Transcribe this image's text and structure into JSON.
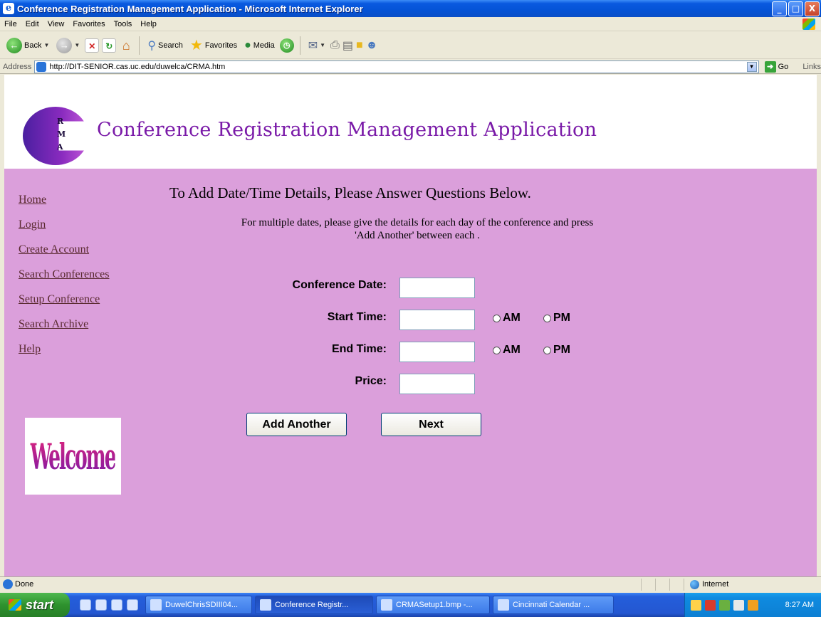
{
  "window": {
    "title": "Conference Registration Management Application - Microsoft Internet Explorer",
    "controls": [
      "_",
      "□",
      "X"
    ]
  },
  "menu": [
    "File",
    "Edit",
    "View",
    "Favorites",
    "Tools",
    "Help"
  ],
  "toolbar": {
    "back": "Back",
    "search": "Search",
    "favorites": "Favorites",
    "media": "Media"
  },
  "address": {
    "label": "Address",
    "url": "http://DIT-SENIOR.cas.uc.edu/duwelca/CRMA.htm",
    "go": "Go",
    "links": "Links"
  },
  "banner": {
    "logo_letters": [
      "R",
      "M",
      "A"
    ],
    "title": "Conference Registration Management Application"
  },
  "nav": [
    {
      "label": "Home"
    },
    {
      "label": "Login"
    },
    {
      "label": "Create Account"
    },
    {
      "label": "Search Conferences"
    },
    {
      "label": "Setup Conference"
    },
    {
      "label": "Search Archive"
    },
    {
      "label": "Help"
    }
  ],
  "welcome_image_text": "Welcome",
  "page": {
    "heading": "To Add Date/Time Details, Please Answer Questions Below.",
    "subtext_line1": "For multiple dates, please give the details for each day of the conference and press",
    "subtext_line2": "'Add Another' between each ."
  },
  "form": {
    "conference_date_label": "Conference Date:",
    "start_time_label": "Start Time:",
    "end_time_label": "End Time:",
    "price_label": "Price:",
    "am": "AM",
    "pm": "PM",
    "conference_date_value": "",
    "start_time_value": "",
    "end_time_value": "",
    "price_value": "",
    "add_another": "Add Another",
    "next": "Next"
  },
  "status": {
    "text": "Done",
    "zone": "Internet"
  },
  "taskbar": {
    "start": "start",
    "tasks": [
      {
        "label": "DuwelChrisSDIII04...",
        "active": false
      },
      {
        "label": "Conference Registr...",
        "active": true
      },
      {
        "label": "CRMASetup1.bmp -...",
        "active": false
      },
      {
        "label": "Cincinnati Calendar ...",
        "active": false
      }
    ],
    "clock": "8:27 AM"
  },
  "colors": {
    "page_background": "#db9fdb",
    "banner_title": "#7a1aa8",
    "link": "#5a2a30"
  }
}
